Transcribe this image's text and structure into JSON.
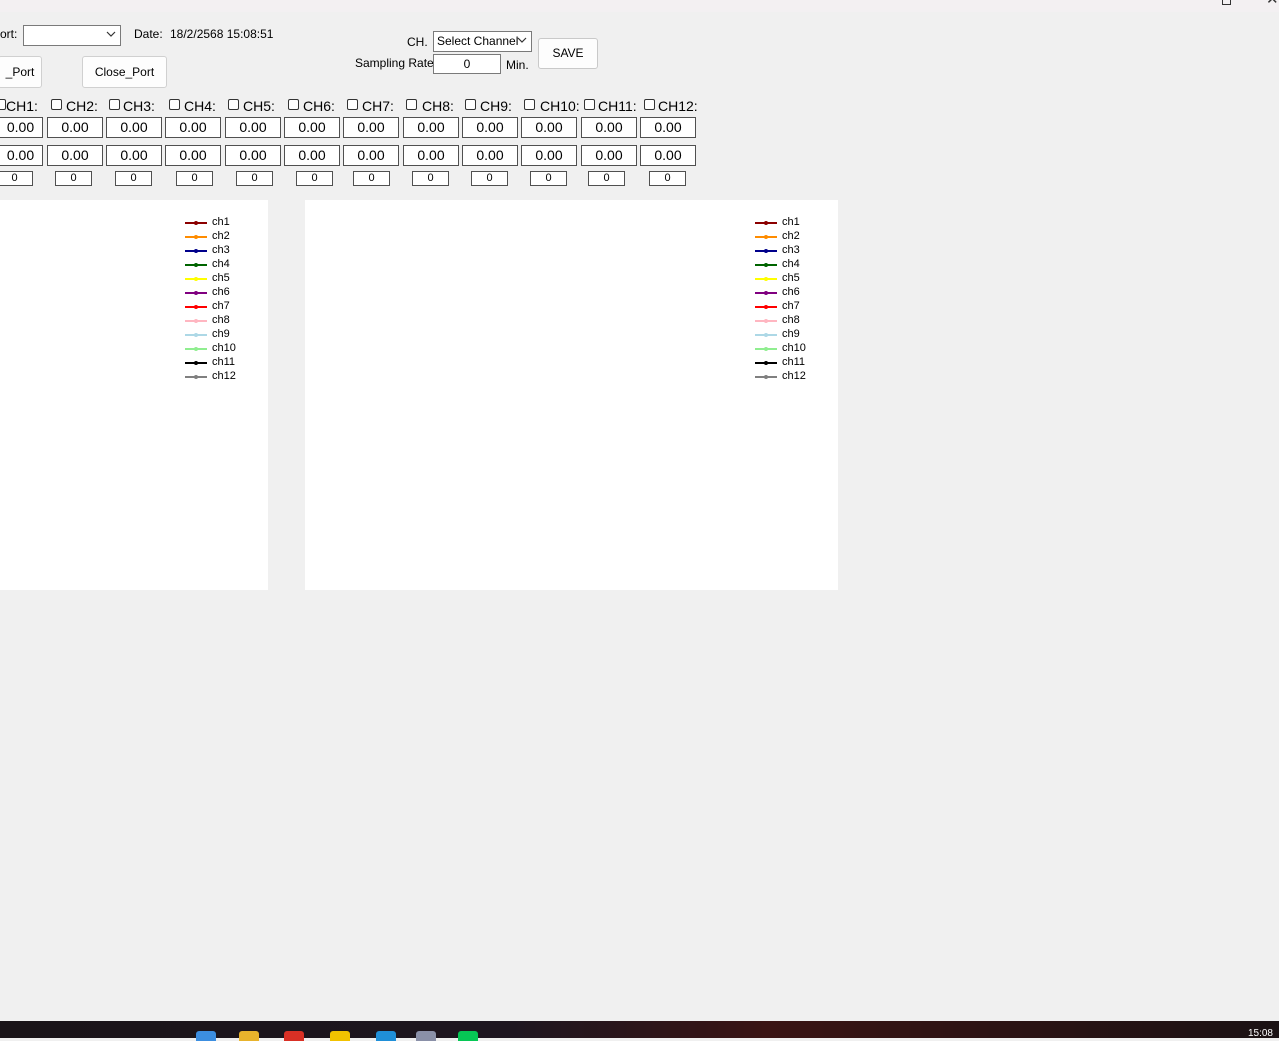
{
  "window": {
    "port_label": "ort:",
    "port_value": "",
    "date_label": "Date:",
    "date_value": "18/2/2568 15:08:51",
    "open_port_label": "_Port",
    "close_port_label": "Close_Port",
    "ch_label": "CH.",
    "ch_select_value": "Select Channel",
    "sampling_label": "Sampling Rate",
    "sampling_value": "0",
    "min_label": "Min.",
    "save_label": "SAVE"
  },
  "channels": [
    {
      "label": "CH1:",
      "value1": "0.00",
      "value2": "0.00",
      "count": "0"
    },
    {
      "label": "CH2:",
      "value1": "0.00",
      "value2": "0.00",
      "count": "0"
    },
    {
      "label": "CH3:",
      "value1": "0.00",
      "value2": "0.00",
      "count": "0"
    },
    {
      "label": "CH4:",
      "value1": "0.00",
      "value2": "0.00",
      "count": "0"
    },
    {
      "label": "CH5:",
      "value1": "0.00",
      "value2": "0.00",
      "count": "0"
    },
    {
      "label": "CH6:",
      "value1": "0.00",
      "value2": "0.00",
      "count": "0"
    },
    {
      "label": "CH7:",
      "value1": "0.00",
      "value2": "0.00",
      "count": "0"
    },
    {
      "label": "CH8:",
      "value1": "0.00",
      "value2": "0.00",
      "count": "0"
    },
    {
      "label": "CH9:",
      "value1": "0.00",
      "value2": "0.00",
      "count": "0"
    },
    {
      "label": "CH10:",
      "value1": "0.00",
      "value2": "0.00",
      "count": "0"
    },
    {
      "label": "CH11:",
      "value1": "0.00",
      "value2": "0.00",
      "count": "0"
    },
    {
      "label": "CH12:",
      "value1": "0.00",
      "value2": "0.00",
      "count": "0"
    }
  ],
  "legend": [
    {
      "name": "ch1",
      "color": "#8b0000"
    },
    {
      "name": "ch2",
      "color": "#ff8c00"
    },
    {
      "name": "ch3",
      "color": "#00008b"
    },
    {
      "name": "ch4",
      "color": "#006400"
    },
    {
      "name": "ch5",
      "color": "#ffff00"
    },
    {
      "name": "ch6",
      "color": "#800080"
    },
    {
      "name": "ch7",
      "color": "#ff0000"
    },
    {
      "name": "ch8",
      "color": "#ffb6c1"
    },
    {
      "name": "ch9",
      "color": "#add8e6"
    },
    {
      "name": "ch10",
      "color": "#90ee90"
    },
    {
      "name": "ch11",
      "color": "#000000"
    },
    {
      "name": "ch12",
      "color": "#808080"
    }
  ],
  "taskbar": {
    "clock": "15:08",
    "icons": [
      {
        "name": "windows-start-icon",
        "color": "#3c8ee0"
      },
      {
        "name": "file-explorer-icon",
        "color": "#e8b32c"
      },
      {
        "name": "chrome-icon",
        "color": "#d93025"
      },
      {
        "name": "pinned-app-icon",
        "color": "#f2c200"
      },
      {
        "name": "edge-icon",
        "color": "#1f8fd8"
      },
      {
        "name": "running-app-icon",
        "color": "#8a90a8"
      },
      {
        "name": "line-app-icon",
        "color": "#06c755"
      }
    ]
  }
}
